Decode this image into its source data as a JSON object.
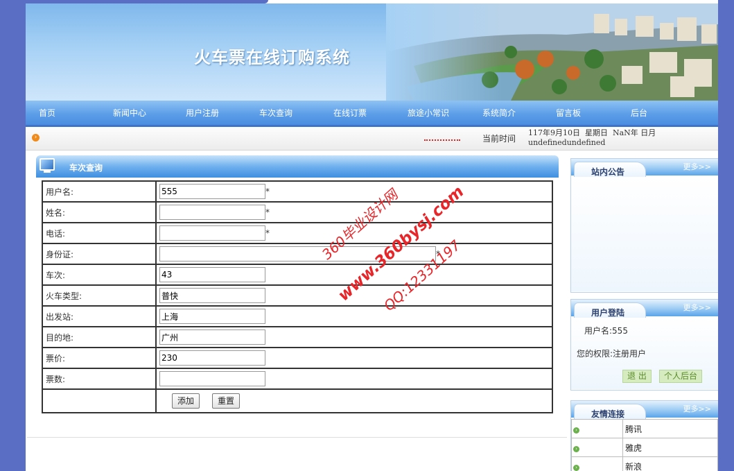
{
  "site": {
    "title": "火车票在线订购系统"
  },
  "nav": {
    "items": [
      {
        "label": "首页"
      },
      {
        "label": "新闻中心"
      },
      {
        "label": "用户注册"
      },
      {
        "label": "车次查询"
      },
      {
        "label": "在线订票"
      },
      {
        "label": "旅途小常识"
      },
      {
        "label": "系统简介"
      },
      {
        "label": "留言板"
      },
      {
        "label": "后台"
      }
    ]
  },
  "infobar": {
    "time_label": "当前时间",
    "time_line1": "117年9月10日  星期日  NaN年 日月",
    "time_line2": "undefinedundefined"
  },
  "main": {
    "panel_title": "车次查询",
    "fields": [
      {
        "label": "用户名:",
        "value": "555",
        "required": "*"
      },
      {
        "label": "姓名:",
        "value": "",
        "required": "*"
      },
      {
        "label": "电话:",
        "value": "",
        "required": "*"
      },
      {
        "label": "身份证:",
        "value": "",
        "required": "*"
      },
      {
        "label": "车次:",
        "value": "43"
      },
      {
        "label": "火车类型:",
        "value": "普快"
      },
      {
        "label": "出发站:",
        "value": "上海"
      },
      {
        "label": "目的地:",
        "value": "广州"
      },
      {
        "label": "票价:",
        "value": "230"
      },
      {
        "label": "票数:",
        "value": ""
      }
    ],
    "add_label": "添加",
    "reset_label": "重置"
  },
  "sidebar": {
    "notice": {
      "title": "站内公告",
      "more": "更多>>"
    },
    "login": {
      "title": "用户登陆",
      "more": "更多>>",
      "username_line": "用户名:555",
      "role_line": "您的权限:注册用户",
      "logout_label": "退 出",
      "personal_label": "个人后台"
    },
    "links": {
      "title": "友情连接",
      "more": "更多>>",
      "items": [
        {
          "name": "腾讯"
        },
        {
          "name": "雅虎"
        },
        {
          "name": "新浪"
        }
      ]
    }
  },
  "watermark": {
    "line1": "360毕业设计网",
    "line2": "www.360bysj.com",
    "line3": "QQ:12331197"
  },
  "colors": {
    "background": "#5a6fc4",
    "nav": "#4a8de0",
    "watermark": "#e8262a"
  }
}
